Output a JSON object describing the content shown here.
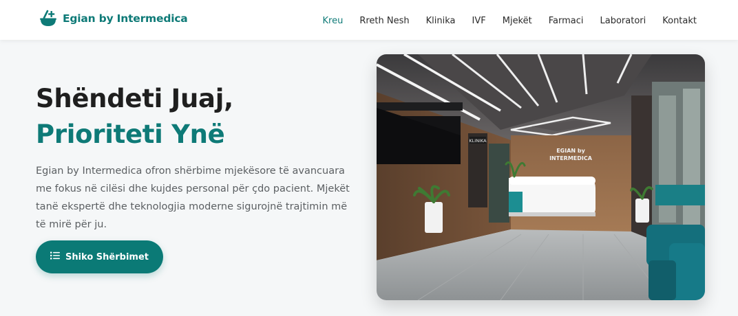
{
  "brand": {
    "name": "Egian by Intermedica",
    "logo_icon": "medical-mortar-plus-icon",
    "color": "#0e7a77"
  },
  "nav": {
    "active": "Kreu",
    "items": [
      "Kreu",
      "Rreth Nesh",
      "Klinika",
      "IVF",
      "Mjekët",
      "Farmaci",
      "Laboratori",
      "Kontakt"
    ]
  },
  "hero": {
    "title_line1": "Shëndeti Juaj,",
    "title_line2": "Prioriteti Ynë",
    "description": "Egian by Intermedica ofron shërbime mjekësore të avancuara me fokus në cilësi dhe kujdes personal për çdo pacient. Mjekët tanë ekspertë dhe teknologjia moderne sigurojnë trajtimin më të mirë për ju.",
    "cta_label": "Shiko Shërbimet",
    "cta_icon": "list-icon"
  },
  "photo": {
    "sign_logo_line1": "EGIAN by",
    "sign_logo_line2": "INTERMEDICA",
    "sign_klinika": "KLINIKA"
  },
  "colors": {
    "accent": "#0e7a77",
    "button": "#0b7a76",
    "background": "#f5f7f8",
    "text": "#1f1f1f"
  }
}
